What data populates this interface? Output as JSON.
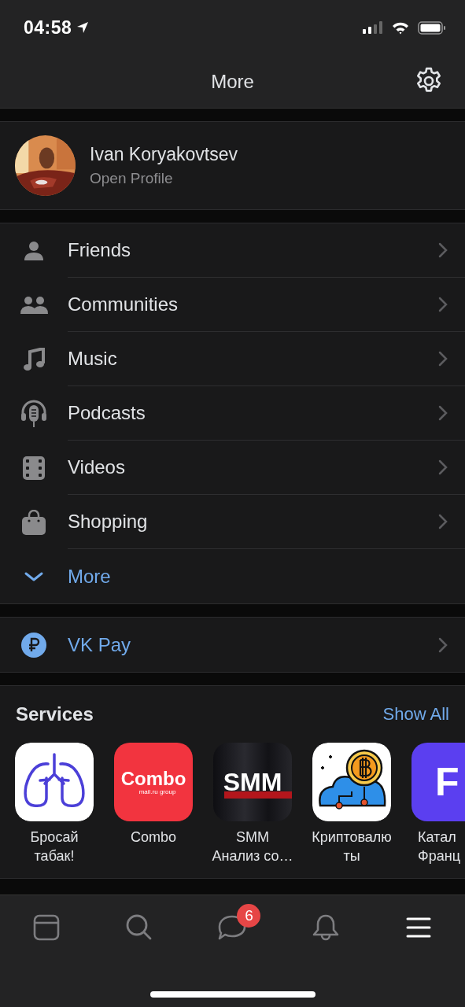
{
  "status_bar": {
    "time": "04:58"
  },
  "header": {
    "title": "More"
  },
  "profile": {
    "name": "Ivan Koryakovtsev",
    "subtitle": "Open Profile"
  },
  "menu": [
    {
      "kind": "link",
      "label": "Friends"
    },
    {
      "kind": "link",
      "label": "Communities"
    },
    {
      "kind": "link",
      "label": "Music"
    },
    {
      "kind": "link",
      "label": "Podcasts"
    },
    {
      "kind": "link",
      "label": "Videos"
    },
    {
      "kind": "link",
      "label": "Shopping"
    },
    {
      "kind": "expand",
      "label": "More"
    }
  ],
  "pay": {
    "label": "VK Pay"
  },
  "services": {
    "title": "Services",
    "show_all": "Show All",
    "items": [
      {
        "kind": "lungs",
        "lines": [
          "Бросай",
          "табак!"
        ]
      },
      {
        "kind": "combo",
        "icon_text": [
          "Combo",
          "mail.ru group"
        ],
        "lines": [
          "Combo"
        ]
      },
      {
        "kind": "smm",
        "icon_text": [
          "SMM"
        ],
        "lines": [
          "SMM",
          "Анализ со…"
        ]
      },
      {
        "kind": "crypto",
        "lines": [
          "Криптовалю",
          "ты"
        ]
      },
      {
        "kind": "letter",
        "icon_text": [
          "F"
        ],
        "lines": [
          "Катал",
          "Франц"
        ]
      }
    ]
  },
  "tab_bar": {
    "tabs": [
      {
        "kind": "feed",
        "selected": false
      },
      {
        "kind": "search",
        "selected": false
      },
      {
        "kind": "messages",
        "selected": false,
        "badge": "6"
      },
      {
        "kind": "notifications",
        "selected": false
      },
      {
        "kind": "menu",
        "selected": true
      }
    ]
  }
}
